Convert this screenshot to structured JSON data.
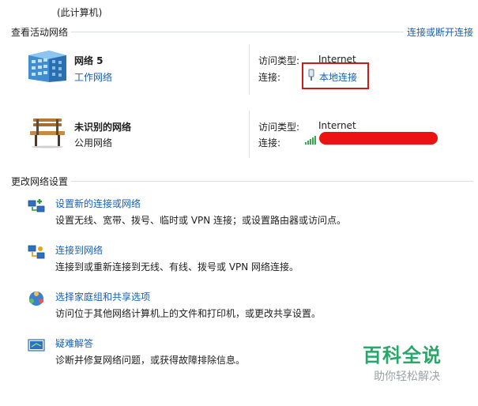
{
  "top_partial": {
    "computer_label": "(此计算机)"
  },
  "active_networks": {
    "title": "查看活动网络",
    "connect_link": "连接或断开连接",
    "networks": [
      {
        "name": "网络  5",
        "type": "工作网络",
        "type_is_link": true,
        "access_label": "访问类型:",
        "access_value": "Internet",
        "connection_label": "连接:",
        "connection_value": "本地连接",
        "connection_icon": "ethernet-plug-icon",
        "network_icon": "building-icon"
      },
      {
        "name": "未识别的网络",
        "type": "公用网络",
        "type_is_link": false,
        "access_label": "访问类型:",
        "access_value": "Internet",
        "connection_label": "连接:",
        "connection_value": "",
        "connection_icon": "wifi-signal-icon",
        "network_icon": "park-bench-icon"
      }
    ]
  },
  "change_settings": {
    "title": "更改网络设置",
    "tasks": [
      {
        "link": "设置新的连接或网络",
        "desc": "设置无线、宽带、拨号、临时或 VPN 连接；或设置路由器或访问点。",
        "icon": "new-connection-icon"
      },
      {
        "link": "连接到网络",
        "desc": "连接到或重新连接到无线、有线、拨号或 VPN 网络连接。",
        "icon": "connect-network-icon"
      },
      {
        "link": "选择家庭组和共享选项",
        "desc": "访问位于其他网络计算机上的文件和打印机，或更改共享设置。",
        "icon": "homegroup-icon"
      },
      {
        "link": "疑难解答",
        "desc": "诊断并修复网络问题，或获得故障排除信息。",
        "icon": "troubleshoot-icon"
      }
    ]
  },
  "colors": {
    "link": "#1a5fb4",
    "highlight": "#d01a1a",
    "watermark": "#2aa66a"
  },
  "watermark": {
    "title": "百科全说",
    "subtitle": "助你轻松解决"
  }
}
